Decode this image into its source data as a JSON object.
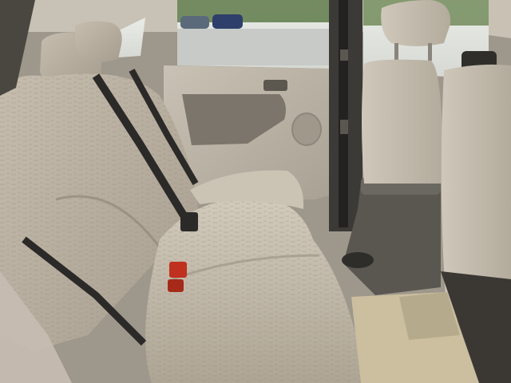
{
  "scene": {
    "subject": "car-interior-rear-seat",
    "colors": {
      "upholstery": "#bfb6a6",
      "upholstery_shadow": "#8f877a",
      "plastic_trim": "#b9b2a6",
      "dark_trim": "#4a4741",
      "seatbelt": "#2b2a28",
      "buckle_red": "#c0301f",
      "sky": "#dfe3df",
      "foliage": "#5f7a4a",
      "floor_carpet": "#cbbf9f"
    }
  }
}
